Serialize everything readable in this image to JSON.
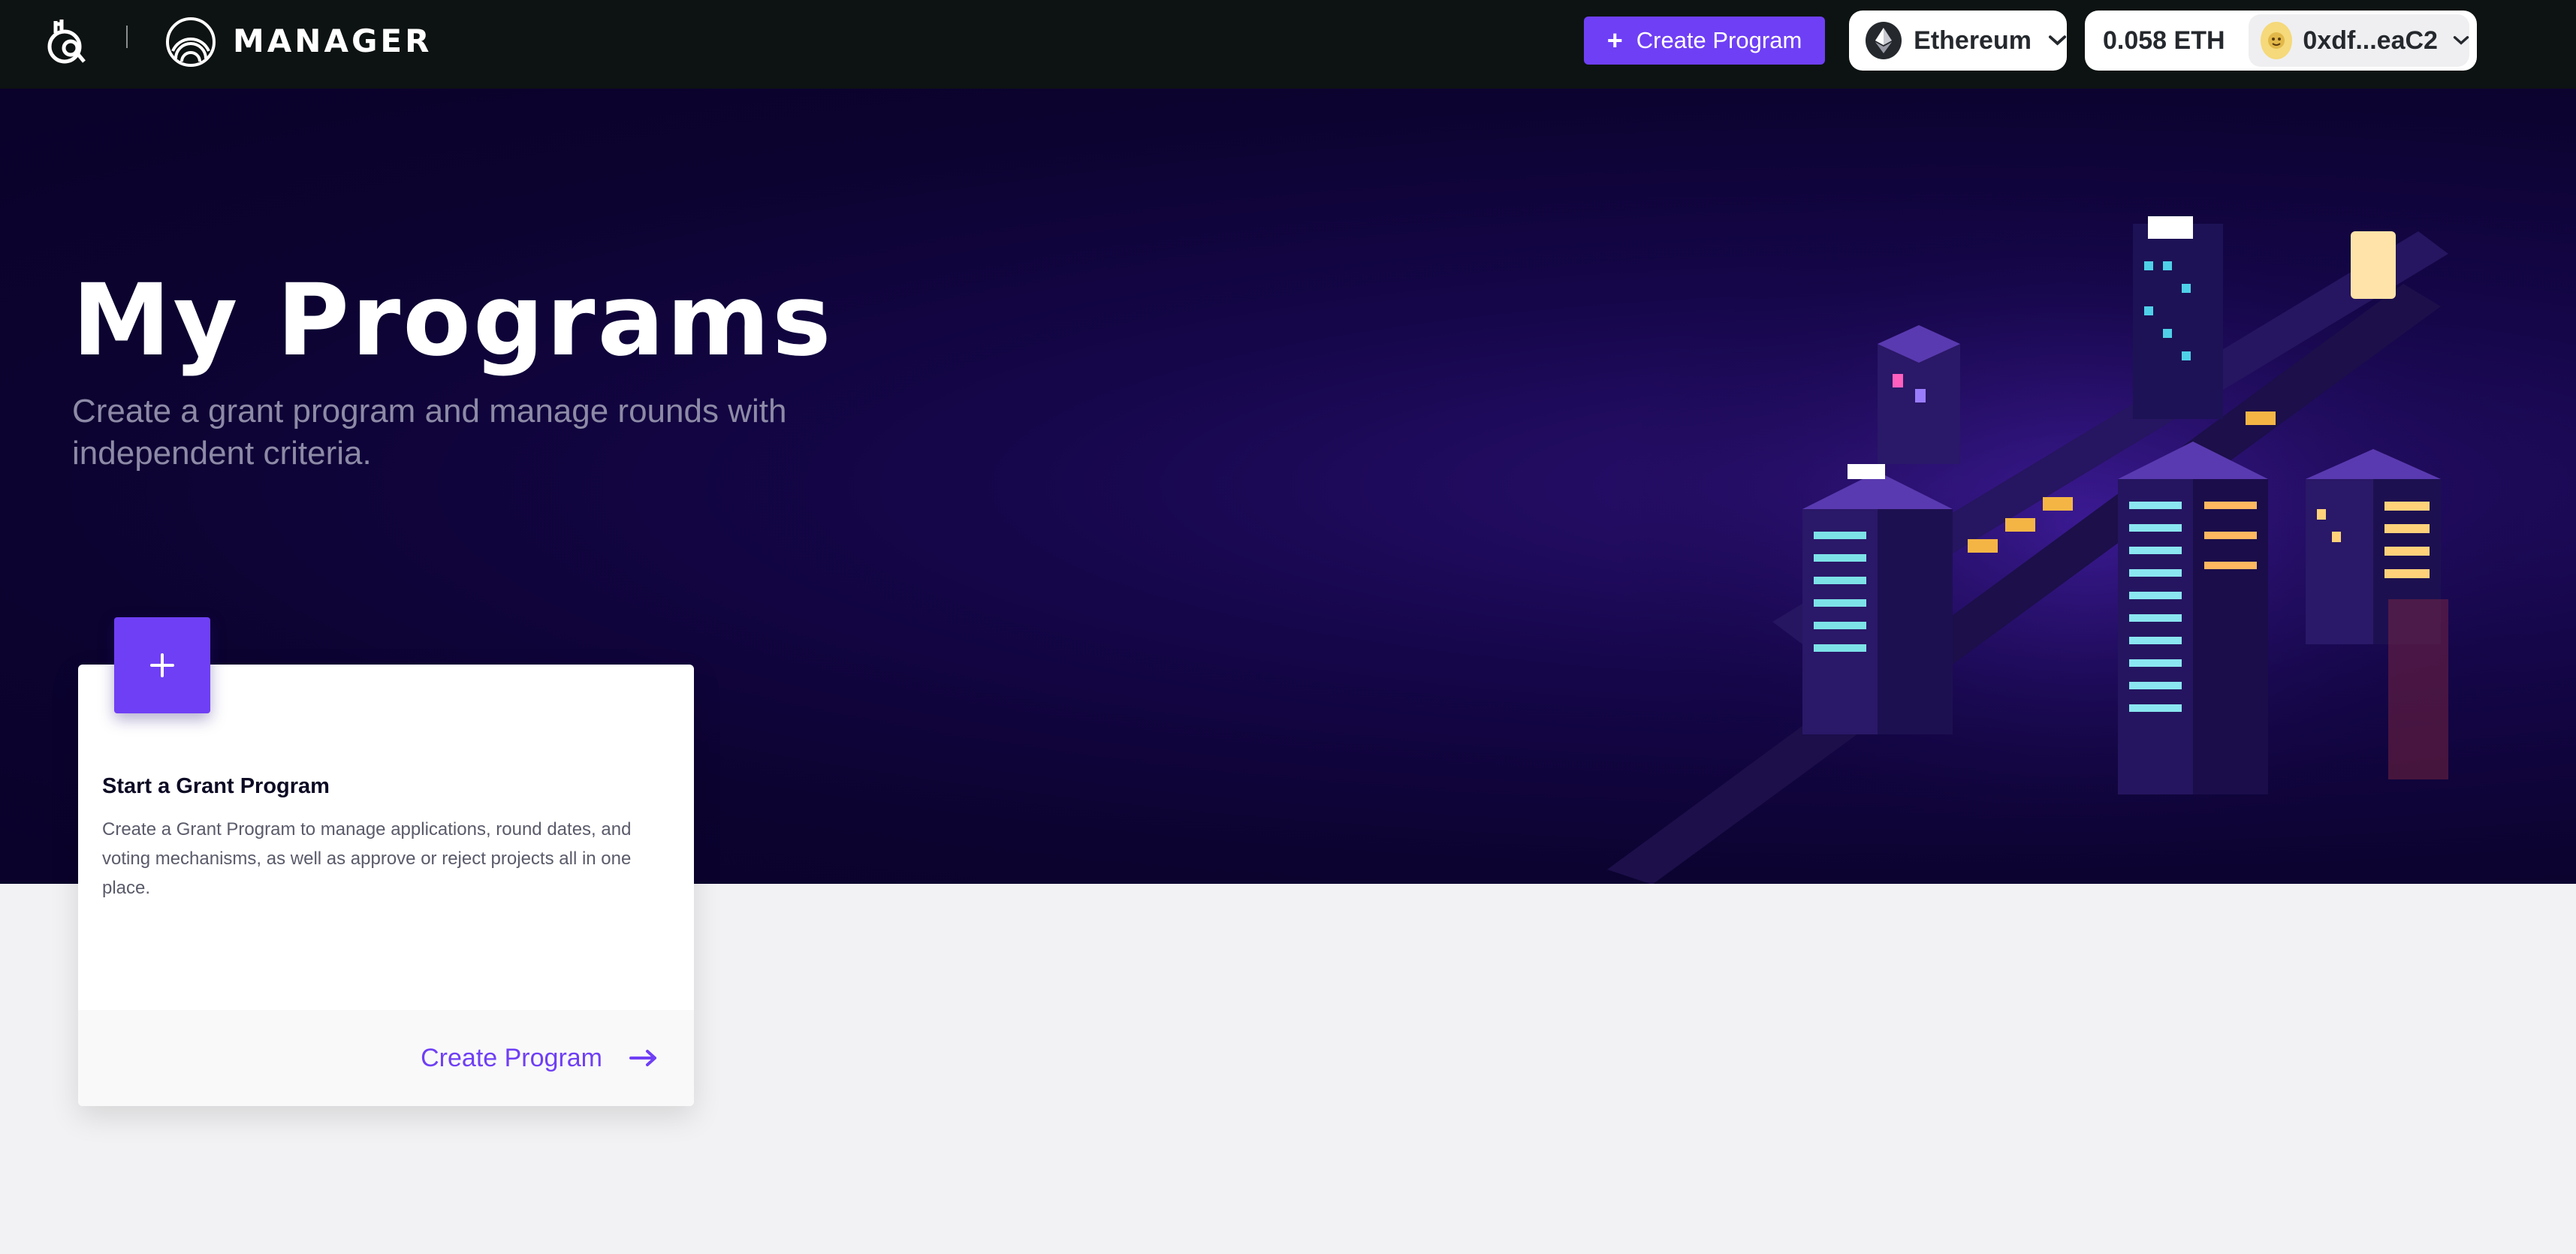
{
  "nav": {
    "brand": "MANAGER",
    "create_button": {
      "label": "Create Program",
      "icon": "plus-icon"
    },
    "network": {
      "label": "Ethereum",
      "icon": "ethereum-icon"
    },
    "account": {
      "balance": "0.058 ETH",
      "address": "0xdf...eaC2"
    }
  },
  "hero": {
    "title": "My Programs",
    "subtitle": "Create a grant program and manage rounds with independent criteria."
  },
  "card": {
    "title": "Start a Grant Program",
    "description": "Create a Grant Program to manage applications, round dates, and voting mechanisms, as well as approve or reject projects all in one place.",
    "link_label": "Create Program"
  },
  "colors": {
    "accent": "#6f3ff5",
    "nav_bg": "#0d1312",
    "hero_bg": "#0c0330",
    "page_bg": "#f2f2f4"
  }
}
